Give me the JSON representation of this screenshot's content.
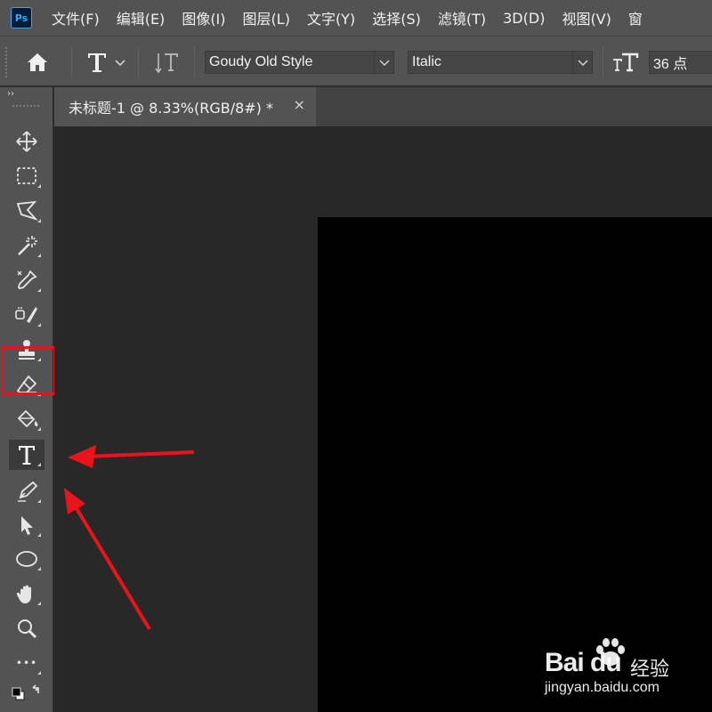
{
  "app": {
    "logo_text": "Ps"
  },
  "menu": [
    "文件(F)",
    "编辑(E)",
    "图像(I)",
    "图层(L)",
    "文字(Y)",
    "选择(S)",
    "滤镜(T)",
    "3D(D)",
    "视图(V)",
    "窗"
  ],
  "options_bar": {
    "font_family": "Goudy Old Style",
    "font_style": "Italic",
    "font_size": "36 点"
  },
  "document_tab": {
    "title": "未标题-1 @ 8.33%(RGB/8#) *",
    "close_glyph": "×"
  },
  "toolbar": {
    "collapse_glyph": "››",
    "tools": [
      "move-tool",
      "marquee-tool",
      "lasso-tool",
      "magic-wand-tool",
      "eyedropper-tool",
      "healing-brush-tool",
      "clone-stamp-tool",
      "eraser-tool",
      "paint-bucket-tool",
      "type-tool",
      "pen-tool",
      "path-selection-tool",
      "ellipse-tool",
      "hand-tool",
      "zoom-tool",
      "more-tools",
      "default-colors-swap"
    ],
    "active_tool": "type-tool",
    "more_glyph": "•••"
  },
  "watermark": {
    "brand": "Bai du",
    "brand_cn": "经验",
    "url": "jingyan.baidu.com"
  },
  "colors": {
    "ui_panel": "#535353",
    "canvas_bg": "#282828",
    "document": "#000000",
    "annotation_red": "#e8141c",
    "ps_blue": "#31a8ff"
  }
}
